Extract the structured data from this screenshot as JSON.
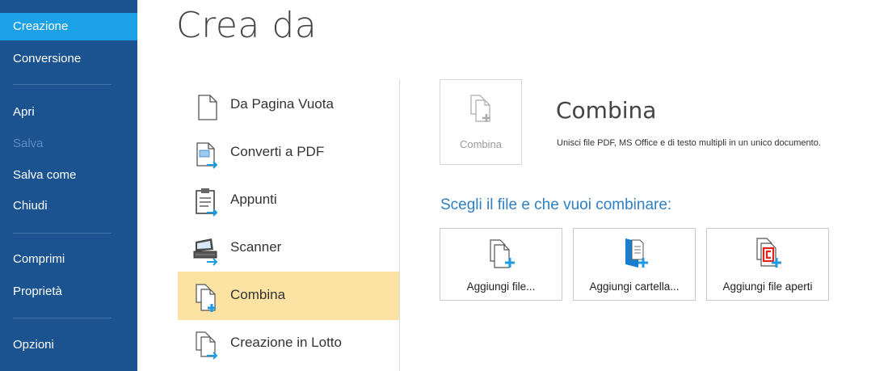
{
  "sidebar": {
    "items": [
      {
        "label": "Creazione",
        "state": "active"
      },
      {
        "label": "Conversione",
        "state": "normal"
      },
      {
        "label": "Apri",
        "state": "normal"
      },
      {
        "label": "Salva",
        "state": "disabled"
      },
      {
        "label": "Salva come",
        "state": "normal"
      },
      {
        "label": "Chiudi",
        "state": "normal"
      },
      {
        "label": "Comprimi",
        "state": "normal"
      },
      {
        "label": "Proprietà",
        "state": "normal"
      },
      {
        "label": "Opzioni",
        "state": "normal"
      }
    ]
  },
  "header": {
    "title": "Crea da"
  },
  "sources": {
    "items": [
      {
        "label": "Da Pagina Vuota",
        "icon": "blank-page-icon"
      },
      {
        "label": "Converti a PDF",
        "icon": "convert-pdf-icon"
      },
      {
        "label": "Appunti",
        "icon": "clipboard-icon"
      },
      {
        "label": "Scanner",
        "icon": "scanner-icon"
      },
      {
        "label": "Combina",
        "icon": "combine-icon",
        "selected": true
      },
      {
        "label": "Creazione in Lotto",
        "icon": "batch-create-icon"
      }
    ]
  },
  "panel": {
    "tile_label": "Combina",
    "title": "Combina",
    "description": "Unisci file PDF, MS Office e di testo multipli in un unico documento.",
    "choose_label": "Scegli il file e che vuoi combinare:",
    "buttons": [
      {
        "label": "Aggiungi file...",
        "icon": "add-file-icon"
      },
      {
        "label": "Aggiungi cartella...",
        "icon": "add-folder-icon"
      },
      {
        "label": "Aggiungi file aperti",
        "icon": "add-open-files-icon"
      }
    ]
  },
  "colors": {
    "sidebar_bg": "#1a5390",
    "sidebar_active": "#1da1e6",
    "selected_row": "#fce2a3",
    "accent_blue": "#2f7fc5",
    "plus_blue": "#1e9be0",
    "open_file_red": "#e2231a"
  }
}
